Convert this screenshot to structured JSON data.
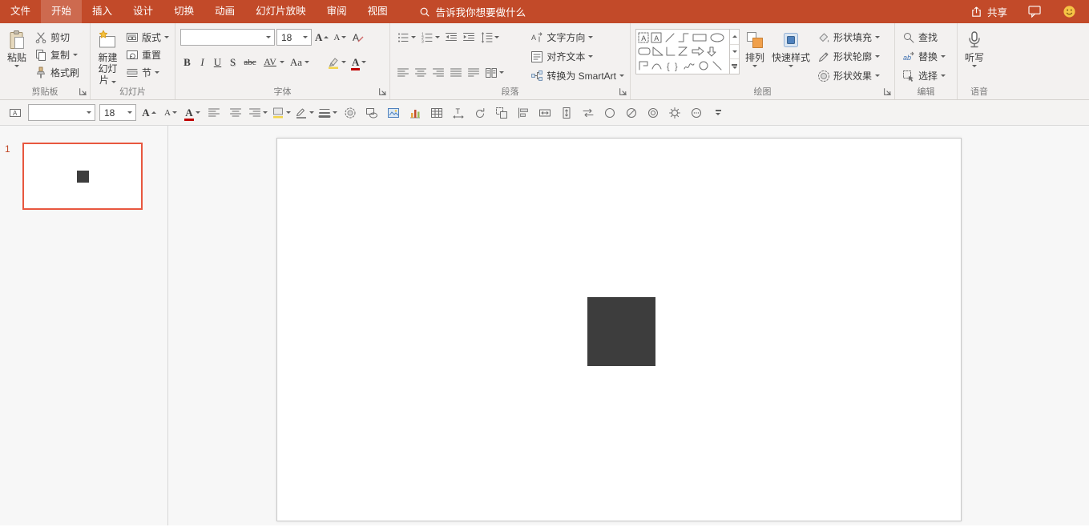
{
  "app": {
    "name": "PowerPoint"
  },
  "colors": {
    "accent": "#C24A29",
    "selected_slide_border": "#E8573F",
    "shape_fill": "#3D3D3D",
    "ribbon_bg": "#F3F1F0"
  },
  "titlebar": {
    "tabs": [
      {
        "label": "文件",
        "active": false
      },
      {
        "label": "开始",
        "active": true
      },
      {
        "label": "插入",
        "active": false
      },
      {
        "label": "设计",
        "active": false
      },
      {
        "label": "切换",
        "active": false
      },
      {
        "label": "动画",
        "active": false
      },
      {
        "label": "幻灯片放映",
        "active": false
      },
      {
        "label": "审阅",
        "active": false
      },
      {
        "label": "视图",
        "active": false
      }
    ],
    "search_label": "告诉我你想要做什么",
    "share_label": "共享"
  },
  "ribbon": {
    "clipboard": {
      "label": "剪贴板",
      "paste": "粘贴",
      "cut": "剪切",
      "copy": "复制",
      "format_painter": "格式刷"
    },
    "slides": {
      "label": "幻灯片",
      "new_slide_line1": "新建",
      "new_slide_line2": "幻灯片",
      "layout": "版式",
      "reset": "重置",
      "section": "节"
    },
    "font": {
      "label": "字体",
      "font_name_value": "",
      "font_size_value": "18",
      "bold": "B",
      "italic": "I",
      "underline": "U",
      "shadow": "S",
      "strikethrough": "abc",
      "char_spacing": "AV",
      "change_case": "Aa",
      "grow_font": "A",
      "shrink_font": "A",
      "clear_format": "A",
      "font_color": "A"
    },
    "paragraph": {
      "label": "段落",
      "text_direction": "文字方向",
      "align_text": "对齐文本",
      "convert_smartart": "转换为 SmartArt"
    },
    "drawing": {
      "label": "绘图",
      "arrange": "排列",
      "quick_styles": "快速样式",
      "shape_fill": "形状填充",
      "shape_outline": "形状轮廓",
      "shape_effects": "形状效果"
    },
    "editing": {
      "label": "编辑",
      "find": "查找",
      "replace": "替换",
      "select": "选择"
    },
    "voice": {
      "label": "语音",
      "dictate": "听写"
    }
  },
  "quickbar": {
    "font_name_value": "",
    "font_size_value": "18",
    "grow_font": "A",
    "shrink_font": "A",
    "font_color": "A"
  },
  "slide_panel": {
    "slides": [
      {
        "number": "1",
        "selected": true
      }
    ]
  },
  "icon_names": [
    "search-icon",
    "share-icon",
    "comments-icon",
    "smiley-icon",
    "paste-icon",
    "cut-icon",
    "copy-icon",
    "format-painter-icon",
    "dialog-launcher-icon",
    "new-slide-icon",
    "layout-icon",
    "reset-icon",
    "section-icon",
    "grow-font-icon",
    "shrink-font-icon",
    "clear-format-icon",
    "highlight-pen-icon",
    "font-color-icon",
    "bullets-icon",
    "numbering-icon",
    "outdent-icon",
    "indent-icon",
    "line-spacing-icon",
    "align-left-icon",
    "align-center-icon",
    "align-right-icon",
    "align-justify-icon",
    "distribute-icon",
    "columns-icon",
    "text-direction-icon",
    "align-text-icon",
    "smartart-icon",
    "shapes-gallery",
    "arrange-icon",
    "quick-styles-icon",
    "shape-fill-icon",
    "shape-outline-icon",
    "shape-effects-icon",
    "find-icon",
    "replace-icon",
    "select-icon",
    "microphone-icon",
    "insert-textbox-icon",
    "fill-color-icon",
    "outline-color-icon",
    "line-style-icon",
    "effects-icon",
    "shape-icon",
    "image-icon",
    "chart-icon",
    "table-icon",
    "text-spacing-icon",
    "rotate-icon",
    "group-icon",
    "align-objects-icon",
    "match-width-icon",
    "match-height-icon",
    "swap-icon",
    "circle-icon",
    "no-fill-icon",
    "ring-icon",
    "gear-icon",
    "more-tools-icon",
    "collapse-toolbar-icon"
  ]
}
